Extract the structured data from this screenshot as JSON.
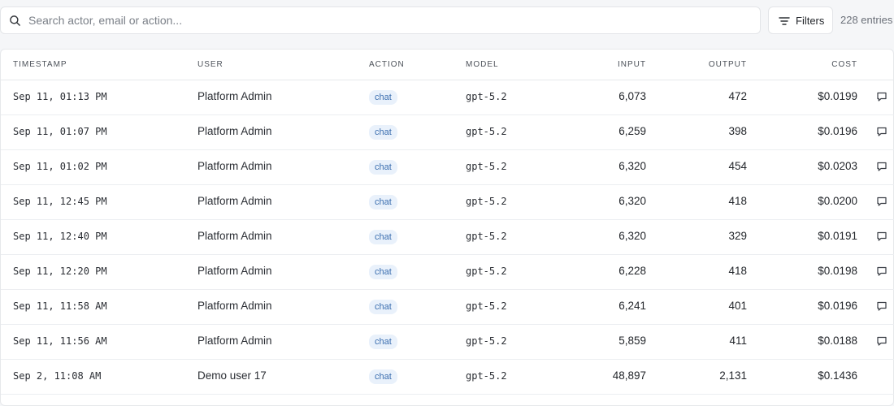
{
  "search": {
    "placeholder": "Search actor, email or action..."
  },
  "toolbar": {
    "filters_label": "Filters",
    "entries_count": "228 entries"
  },
  "table": {
    "headers": {
      "timestamp": "TIMESTAMP",
      "user": "USER",
      "action": "ACTION",
      "model": "MODEL",
      "input": "INPUT",
      "output": "OUTPUT",
      "cost": "COST"
    },
    "rows": [
      {
        "timestamp": "Sep 11, 01:13 PM",
        "user": "Platform Admin",
        "action": "chat",
        "model": "gpt-5.2",
        "input": "6,073",
        "output": "472",
        "cost": "$0.0199",
        "has_chat_icon": true
      },
      {
        "timestamp": "Sep 11, 01:07 PM",
        "user": "Platform Admin",
        "action": "chat",
        "model": "gpt-5.2",
        "input": "6,259",
        "output": "398",
        "cost": "$0.0196",
        "has_chat_icon": true
      },
      {
        "timestamp": "Sep 11, 01:02 PM",
        "user": "Platform Admin",
        "action": "chat",
        "model": "gpt-5.2",
        "input": "6,320",
        "output": "454",
        "cost": "$0.0203",
        "has_chat_icon": true
      },
      {
        "timestamp": "Sep 11, 12:45 PM",
        "user": "Platform Admin",
        "action": "chat",
        "model": "gpt-5.2",
        "input": "6,320",
        "output": "418",
        "cost": "$0.0200",
        "has_chat_icon": true
      },
      {
        "timestamp": "Sep 11, 12:40 PM",
        "user": "Platform Admin",
        "action": "chat",
        "model": "gpt-5.2",
        "input": "6,320",
        "output": "329",
        "cost": "$0.0191",
        "has_chat_icon": true
      },
      {
        "timestamp": "Sep 11, 12:20 PM",
        "user": "Platform Admin",
        "action": "chat",
        "model": "gpt-5.2",
        "input": "6,228",
        "output": "418",
        "cost": "$0.0198",
        "has_chat_icon": true
      },
      {
        "timestamp": "Sep 11, 11:58 AM",
        "user": "Platform Admin",
        "action": "chat",
        "model": "gpt-5.2",
        "input": "6,241",
        "output": "401",
        "cost": "$0.0196",
        "has_chat_icon": true
      },
      {
        "timestamp": "Sep 11, 11:56 AM",
        "user": "Platform Admin",
        "action": "chat",
        "model": "gpt-5.2",
        "input": "5,859",
        "output": "411",
        "cost": "$0.0188",
        "has_chat_icon": true
      },
      {
        "timestamp": "Sep 2, 11:08 AM",
        "user": "Demo user 17",
        "action": "chat",
        "model": "gpt-5.2",
        "input": "48,897",
        "output": "2,131",
        "cost": "$0.1436",
        "has_chat_icon": false
      }
    ]
  },
  "icons": {
    "search": "search-icon",
    "filters": "filter-lines-icon",
    "row_action": "chat-bubble-icon"
  },
  "colors": {
    "badge_bg": "#e9f1fb",
    "badge_text": "#3c6fb0",
    "border": "#e6e8eb"
  }
}
